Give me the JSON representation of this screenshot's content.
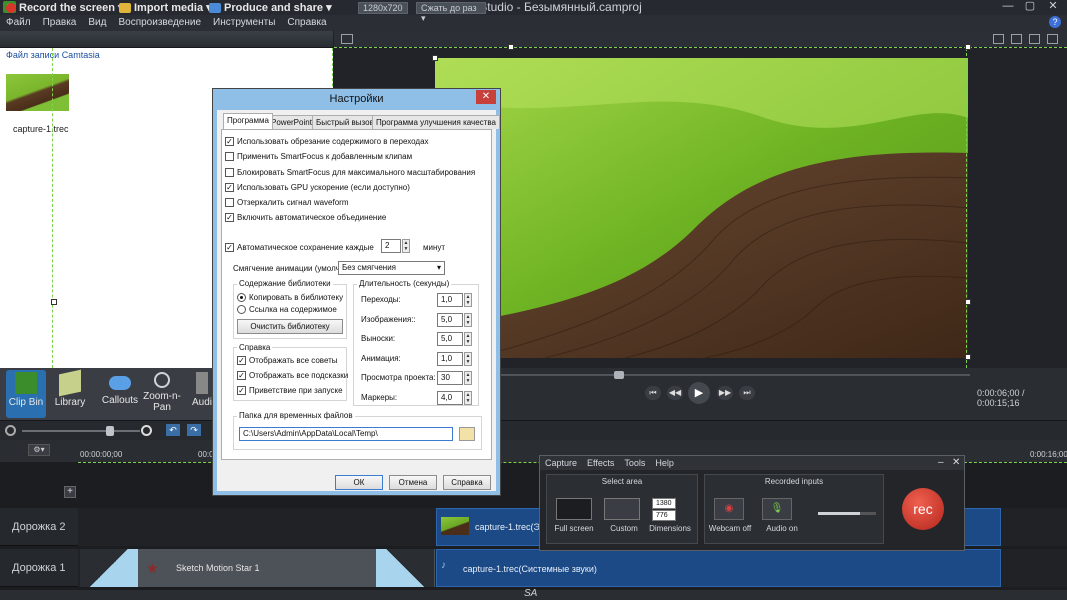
{
  "titlebar": {
    "title": "Camtasia Studio - Безымянный.camproj",
    "icon": "C",
    "minimize": "—",
    "restore": "▢",
    "close": "✕"
  },
  "menu": [
    "Файл",
    "Правка",
    "Вид",
    "Воспроизведение",
    "Инструменты",
    "Справка"
  ],
  "toolbar": {
    "record": "Record the screen",
    "import": "Import media",
    "produce": "Produce and share"
  },
  "preview_bar": {
    "resolution": "1280x720",
    "fit": "Сжать до раз"
  },
  "clip_bin": {
    "title": "Файл записи Camtasia",
    "clip_name": "capture-1.trec"
  },
  "playback": {
    "time": "0:00:06;00 / 0:00:15;16"
  },
  "tabs": [
    "Clip Bin",
    "Library",
    "Callouts",
    "Zoom-n-Pan",
    "Audio"
  ],
  "timeline": {
    "ruler_labels": [
      "00:00:00;00",
      "00:0",
      "0:00:16;00"
    ]
  },
  "tracks": [
    {
      "label": "Дорожка 2",
      "clip": "capture-1.trec(Экр"
    },
    {
      "label": "Дорожка 1",
      "clip_left": "Sketch Motion Star 1",
      "clip_right": "capture-1.trec(Системные звуки)"
    }
  ],
  "watermark": "SA",
  "dialog": {
    "title": "Настройки",
    "close": "✕",
    "tabs": [
      "Программа",
      "PowerPoint",
      "Быстрый вызов",
      "Программа улучшения качества"
    ],
    "checkboxes": [
      {
        "label": "Использовать обрезание содержимого в переходах",
        "checked": true
      },
      {
        "label": "Применить SmartFocus к добавленным клипам",
        "checked": false
      },
      {
        "label": "Блокировать SmartFocus для максимального масштабирования",
        "checked": false
      },
      {
        "label": "Использовать GPU ускорение (если доступно)",
        "checked": true
      },
      {
        "label": "Отзеркалить сигнал waveform",
        "checked": false
      },
      {
        "label": "Включить автоматическое объединение",
        "checked": true
      }
    ],
    "autosave": {
      "label": "Автоматическое сохранение каждые",
      "value": "2",
      "unit": "минут",
      "checked": true
    },
    "easing": {
      "label": "Смягчение анимации (умолч):",
      "value": "Без смягчения"
    },
    "library": {
      "title": "Содержание библиотеки",
      "copy": "Копировать в библиотеку",
      "link": "Ссылка на содержимое",
      "clear": "Очистить библиотеку"
    },
    "help": {
      "title": "Справка",
      "items": [
        "Отображать все советы",
        "Отображать все подсказки",
        "Приветствие при запуске"
      ]
    },
    "durations": {
      "title": "Длительность (секунды)",
      "rows": [
        {
          "label": "Переходы:",
          "value": "1,0"
        },
        {
          "label": "Изображения::",
          "value": "5,0"
        },
        {
          "label": "Выноски:",
          "value": "5,0"
        },
        {
          "label": "Анимация:",
          "value": "1,0"
        },
        {
          "label": "Просмотра проекта:",
          "value": "30"
        },
        {
          "label": "Маркеры:",
          "value": "4,0"
        }
      ]
    },
    "temp": {
      "title": "Папка для временных файлов",
      "path": "C:\\Users\\Admin\\AppData\\Local\\Temp\\"
    },
    "buttons": {
      "ok": "ОК",
      "cancel": "Отмена",
      "help": "Справка"
    }
  },
  "recorder": {
    "menu": [
      "Capture",
      "Effects",
      "Tools",
      "Help"
    ],
    "min": "–",
    "close": "✕",
    "select_area": "Select area",
    "full_screen": "Full screen",
    "custom": "Custom",
    "dimensions": "Dimensions",
    "width": "1380",
    "height": "776",
    "recorded_inputs": "Recorded inputs",
    "webcam": "Webcam off",
    "audio": "Audio on",
    "rec": "rec",
    "volume_level": 0.72
  },
  "colors": {
    "accent_green": "#7ed34a",
    "rec_red": "#d93a2f",
    "dialog_title": "#8fbfe6"
  }
}
